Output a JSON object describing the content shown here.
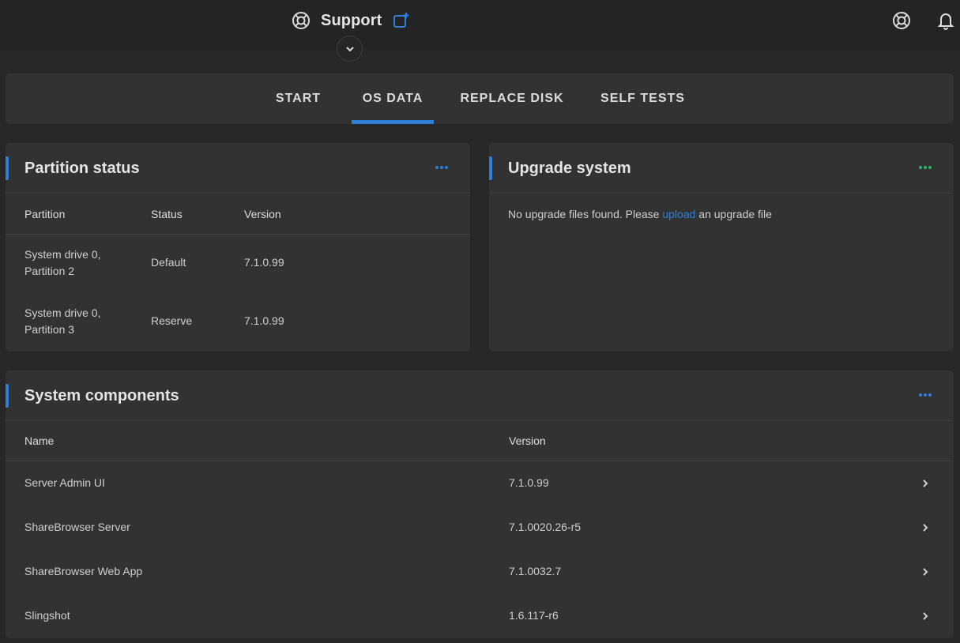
{
  "header": {
    "title": "Support",
    "title_icon": "lifebuoy-icon",
    "actions": [
      "lifebuoy-icon",
      "bell-icon"
    ]
  },
  "tabs": [
    {
      "label": "START",
      "active": false
    },
    {
      "label": "OS DATA",
      "active": true
    },
    {
      "label": "REPLACE DISK",
      "active": false
    },
    {
      "label": "SELF TESTS",
      "active": false
    }
  ],
  "partition_status": {
    "title": "Partition status",
    "columns": [
      "Partition",
      "Status",
      "Version"
    ],
    "rows": [
      {
        "partition_line1": "System drive 0,",
        "partition_line2": "Partition 2",
        "status": "Default",
        "version": "7.1.0.99"
      },
      {
        "partition_line1": "System drive 0,",
        "partition_line2": "Partition 3",
        "status": "Reserve",
        "version": "7.1.0.99"
      }
    ]
  },
  "upgrade_system": {
    "title": "Upgrade system",
    "text_before": "No upgrade files found. Please ",
    "link": "upload",
    "text_after": " an upgrade file"
  },
  "system_components": {
    "title": "System components",
    "columns": [
      "Name",
      "Version"
    ],
    "rows": [
      {
        "name": "Server Admin UI",
        "version": "7.1.0.99"
      },
      {
        "name": "ShareBrowser Server",
        "version": "7.1.0020.26-r5"
      },
      {
        "name": "ShareBrowser Web App",
        "version": "7.1.0032.7"
      },
      {
        "name": "Slingshot",
        "version": "1.6.117-r6"
      }
    ]
  },
  "colors": {
    "accent": "#2f7fd6",
    "menu_green": "#35b36e",
    "card_bg": "#323232",
    "page_bg": "#272727"
  }
}
